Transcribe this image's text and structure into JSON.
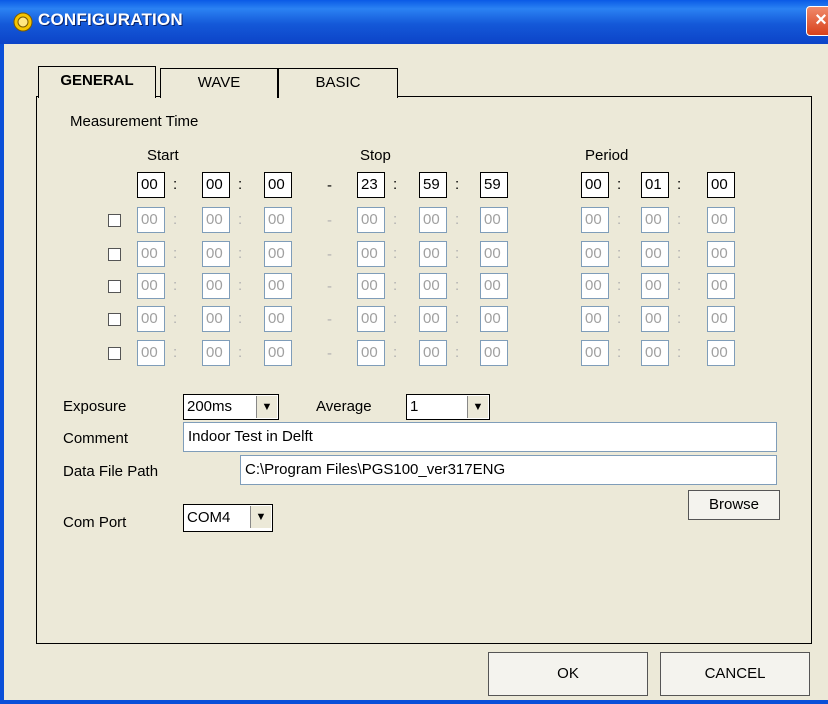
{
  "window": {
    "title": "CONFIGURATION",
    "close_label": "×"
  },
  "tabs": [
    {
      "label": "GENERAL"
    },
    {
      "label": "WAVE"
    },
    {
      "label": "BASIC"
    }
  ],
  "general": {
    "section_label": "Measurement Time",
    "columns": {
      "start": "Start",
      "stop": "Stop",
      "period": "Period"
    },
    "rows": [
      {
        "start": [
          "00",
          "00",
          "00"
        ],
        "stop": [
          "23",
          "59",
          "59"
        ],
        "period": [
          "00",
          "01",
          "00"
        ]
      },
      {
        "start": [
          "00",
          "00",
          "00"
        ],
        "stop": [
          "00",
          "00",
          "00"
        ],
        "period": [
          "00",
          "00",
          "00"
        ]
      },
      {
        "start": [
          "00",
          "00",
          "00"
        ],
        "stop": [
          "00",
          "00",
          "00"
        ],
        "period": [
          "00",
          "00",
          "00"
        ]
      },
      {
        "start": [
          "00",
          "00",
          "00"
        ],
        "stop": [
          "00",
          "00",
          "00"
        ],
        "period": [
          "00",
          "00",
          "00"
        ]
      },
      {
        "start": [
          "00",
          "00",
          "00"
        ],
        "stop": [
          "00",
          "00",
          "00"
        ],
        "period": [
          "00",
          "00",
          "00"
        ]
      },
      {
        "start": [
          "00",
          "00",
          "00"
        ],
        "stop": [
          "00",
          "00",
          "00"
        ],
        "period": [
          "00",
          "00",
          "00"
        ]
      }
    ],
    "colon": ":",
    "dash": "-",
    "exposure": {
      "label": "Exposure",
      "value": "200ms"
    },
    "average": {
      "label": "Average",
      "value": "1"
    },
    "comment": {
      "label": "Comment",
      "value": "Indoor Test in Delft"
    },
    "data_file_path": {
      "label": "Data File Path",
      "value": "C:\\Program Files\\PGS100_ver317ENG"
    },
    "browse_label": "Browse",
    "com_port": {
      "label": "Com Port",
      "value": "COM4"
    },
    "dropdown_arrow": "▼"
  },
  "footer": {
    "ok_label": "OK",
    "cancel_label": "CANCEL"
  }
}
